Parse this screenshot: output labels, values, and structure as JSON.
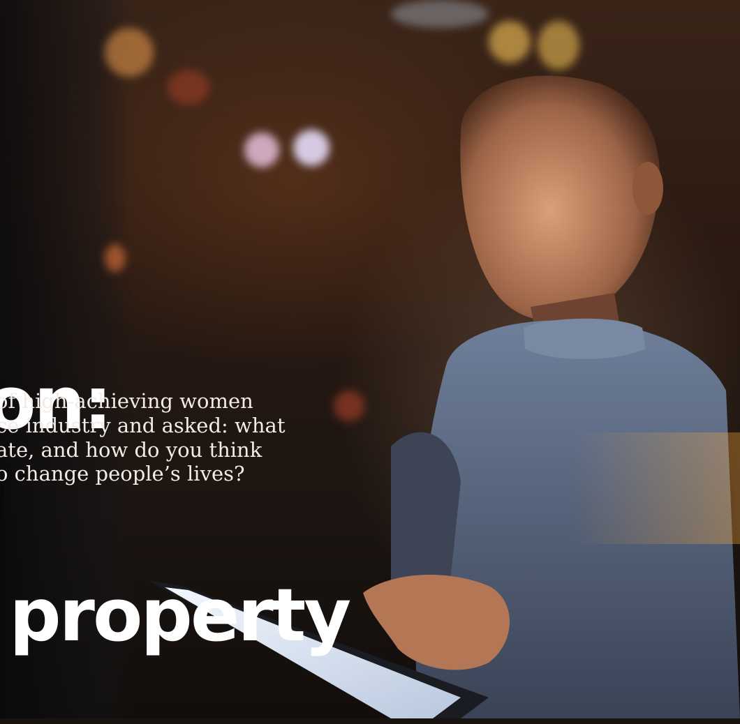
{
  "headline": {
    "line1": "on:",
    "line2": " property"
  },
  "standfirst": {
    "lines": [
      "of high-achieving women",
      "ce industry and asked: what",
      "ate, and how do you think",
      "o change people’s lives?"
    ]
  },
  "photo": {
    "subject": "woman-using-tablet-at-night",
    "palette": {
      "shadow": "#1a1410",
      "amber": "#f2b140",
      "skin": "#c48a66",
      "sweater": "#5b6b86",
      "screen": "#dfe7f2"
    }
  }
}
